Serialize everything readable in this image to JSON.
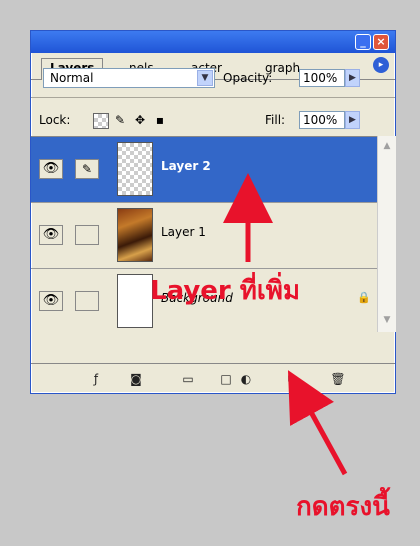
{
  "window": {
    "minimize_glyph": "_",
    "close_glyph": "×"
  },
  "tabs": [
    {
      "label": "Layers",
      "active": true
    },
    {
      "label": "nels",
      "active": false
    },
    {
      "label": "acter",
      "active": false
    },
    {
      "label": "graph",
      "active": false
    }
  ],
  "tab_menu_glyph": "▸",
  "blend_mode": {
    "value": "Normal"
  },
  "opacity": {
    "label": "Opacity:",
    "value": "100%"
  },
  "lock": {
    "label": "Lock:"
  },
  "fill": {
    "label": "Fill:",
    "value": "100%"
  },
  "layers": [
    {
      "name": "Layer 2",
      "selected": true,
      "thumb": "transparent"
    },
    {
      "name": "Layer 1",
      "selected": false,
      "thumb": "artwork"
    },
    {
      "name": "Background",
      "selected": false,
      "thumb": "white",
      "locked": true
    }
  ],
  "annotations": {
    "layer_added": "Layer ที่เพิ่ม",
    "click_here": "กดตรงนี้"
  },
  "colors": {
    "selection": "#3367c8",
    "annotation": "#e8122b",
    "titlebar": "#1f54d6"
  }
}
